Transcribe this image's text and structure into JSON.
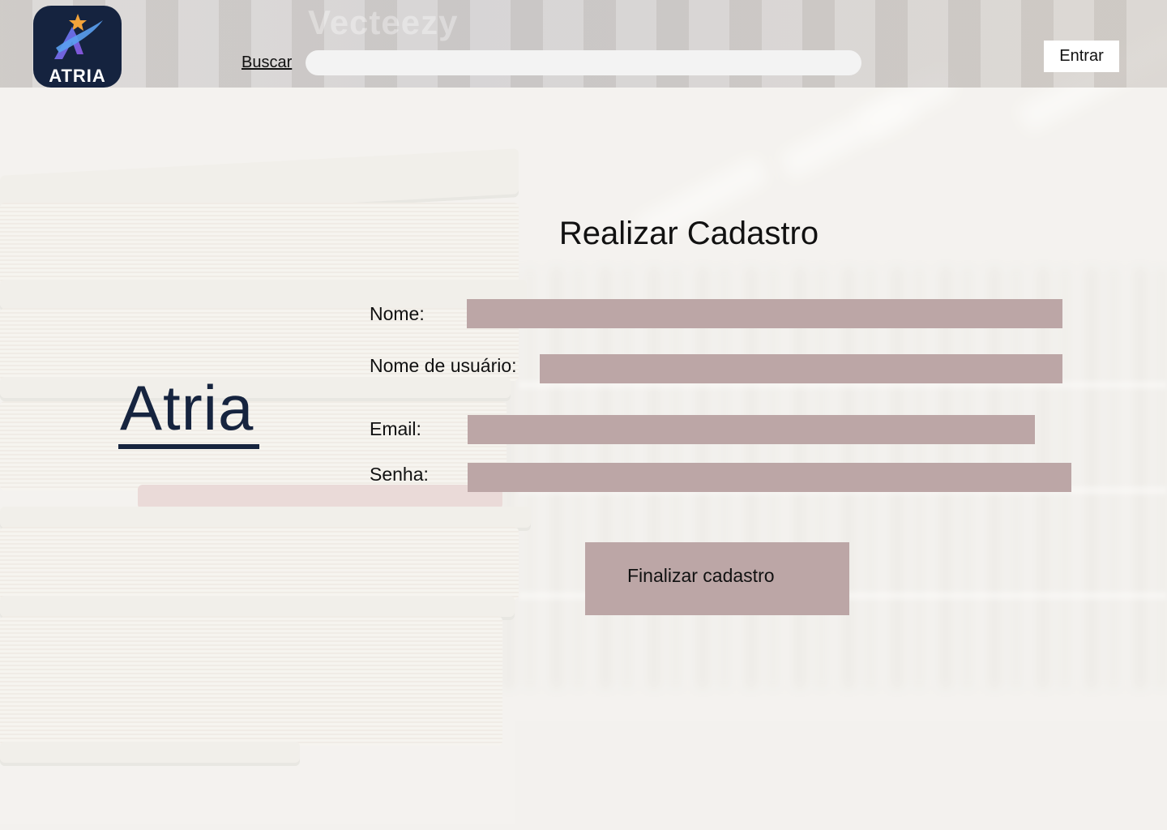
{
  "header": {
    "logo_text": "ATRIA",
    "search_label": "Buscar",
    "search_placeholder": "",
    "login_label": "Entrar",
    "watermark": "Vecteezy"
  },
  "brand": {
    "name": "Atria"
  },
  "form": {
    "title": "Realizar Cadastro",
    "fields": [
      {
        "label": "Nome:",
        "value": ""
      },
      {
        "label": "Nome de usuário:",
        "value": ""
      },
      {
        "label": "Email:",
        "value": ""
      },
      {
        "label": "Senha:",
        "value": ""
      }
    ],
    "submit_label": "Finalizar cadastro"
  },
  "colors": {
    "input_fill": "#bca6a6",
    "brand_navy": "#16243f",
    "logo_bg": "#15233f"
  },
  "icons": {
    "logo": "atria-star-logo-icon"
  }
}
